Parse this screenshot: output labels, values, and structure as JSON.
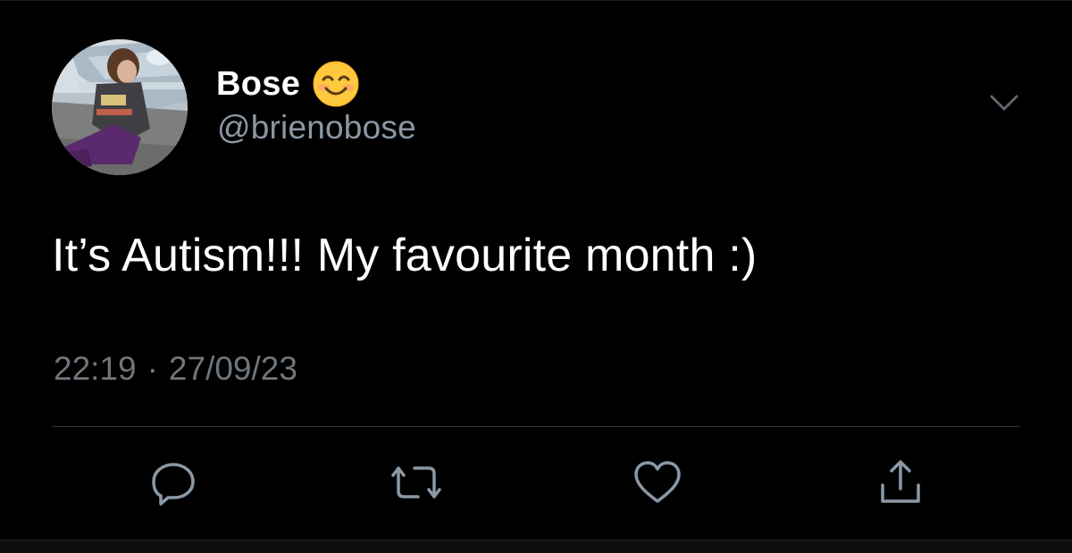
{
  "tweet": {
    "display_name": "Bose",
    "emoji_icon": "smiling-face-icon",
    "handle": "@brienobose",
    "text": "It’s Autism!!! My favourite month :)",
    "time": "22:19",
    "separator": "·",
    "date": "27/09/23"
  },
  "actions": [
    {
      "name": "reply",
      "icon": "reply-icon"
    },
    {
      "name": "retweet",
      "icon": "retweet-icon"
    },
    {
      "name": "like",
      "icon": "heart-icon"
    },
    {
      "name": "share",
      "icon": "share-icon"
    }
  ],
  "colors": {
    "background": "#000000",
    "primary_text": "#ffffff",
    "secondary_text": "#8b98a5",
    "icon_color": "#8b98a5",
    "divider": "#2f3336"
  }
}
